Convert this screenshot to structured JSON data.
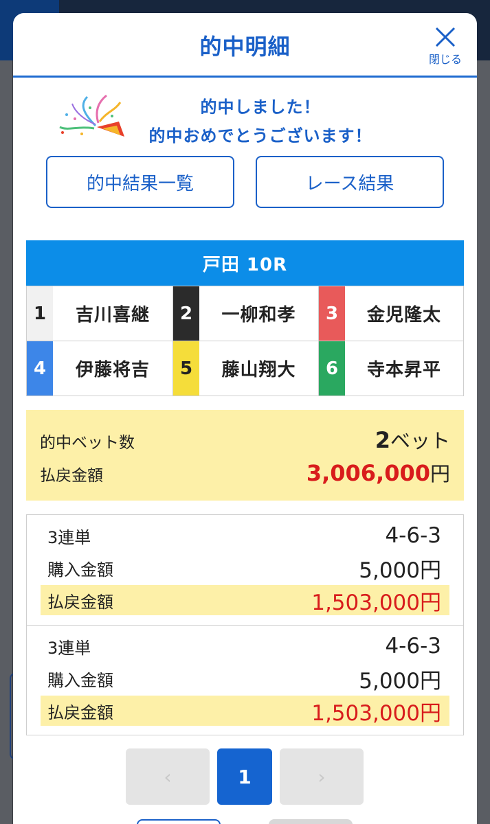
{
  "modal": {
    "title": "的中明細",
    "close_label": "閉じる",
    "congrats_line1": "的中しました！",
    "congrats_line2": "的中おめでとうございます！",
    "btn_hit_list": "的中結果一覧",
    "btn_race_result": "レース結果"
  },
  "race": {
    "header": "戸田 10R",
    "racers": [
      {
        "num": "1",
        "name": "吉川喜継",
        "bg": "#f1f1f1",
        "fg": "#222222"
      },
      {
        "num": "2",
        "name": "一柳和孝",
        "bg": "#2b2b2b",
        "fg": "#ffffff"
      },
      {
        "num": "3",
        "name": "金児隆太",
        "bg": "#e85a5a",
        "fg": "#ffffff"
      },
      {
        "num": "4",
        "name": "伊藤将吉",
        "bg": "#3d86e8",
        "fg": "#ffffff"
      },
      {
        "num": "5",
        "name": "藤山翔大",
        "bg": "#f5dd3a",
        "fg": "#222222"
      },
      {
        "num": "6",
        "name": "寺本昇平",
        "bg": "#2aa860",
        "fg": "#ffffff"
      }
    ]
  },
  "summary": {
    "bets_label": "的中ベット数",
    "bets_value": "2",
    "bets_unit": "ベット",
    "payout_label": "払戻金額",
    "payout_value": "3,006,000",
    "payout_unit": "円"
  },
  "tickets": [
    {
      "type": "3連単",
      "combo": "4-6-3",
      "purchase_label": "購入金額",
      "purchase": "5,000円",
      "payout_label": "払戻金額",
      "payout": "1,503,000円"
    },
    {
      "type": "3連単",
      "combo": "4-6-3",
      "purchase_label": "購入金額",
      "purchase": "5,000円",
      "payout_label": "払戻金額",
      "payout": "1,503,000円"
    }
  ],
  "pager": {
    "prev": "‹",
    "current": "1",
    "next": "›"
  }
}
